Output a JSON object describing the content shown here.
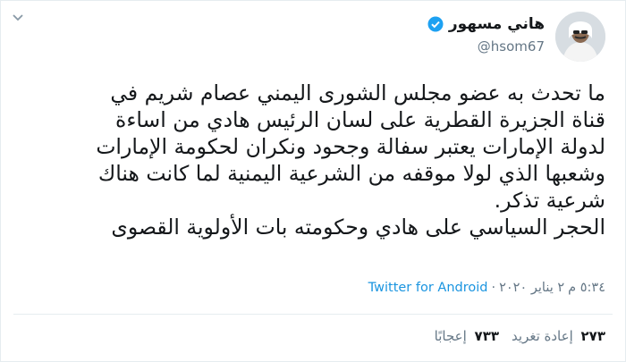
{
  "tweet": {
    "author": {
      "display_name": "هاني مسهور",
      "handle": "@hsom67",
      "avatar_icon": "user-avatar",
      "verified_icon": "verified-badge-icon",
      "verified_color": "#1da1f2"
    },
    "text": "ما تحدث به عضو مجلس الشورى اليمني عصام شريم في\nقناة الجزيرة القطرية على لسان الرئيس هادي من اساءة\nلدولة الإمارات يعتبر سفالة وجحود ونكران لحكومة الإمارات\nوشعبها الذي لولا موقفه من الشرعية اليمنية لما كانت هناك\nشرعية تذكر.\nالحجر السياسي على هادي وحكومته بات الأولوية القصوى",
    "meta": {
      "time": "٥:٣٤ م",
      "separator": "·",
      "date": "٢ يناير ٢٠٢٠",
      "source": "Twitter for Android"
    },
    "stats": {
      "retweets_count": "٢٧٣",
      "retweets_label": "إعادة تغريد",
      "likes_count": "٧٣٣",
      "likes_label": "إعجابًا"
    },
    "link_color": "#1b95e0"
  }
}
